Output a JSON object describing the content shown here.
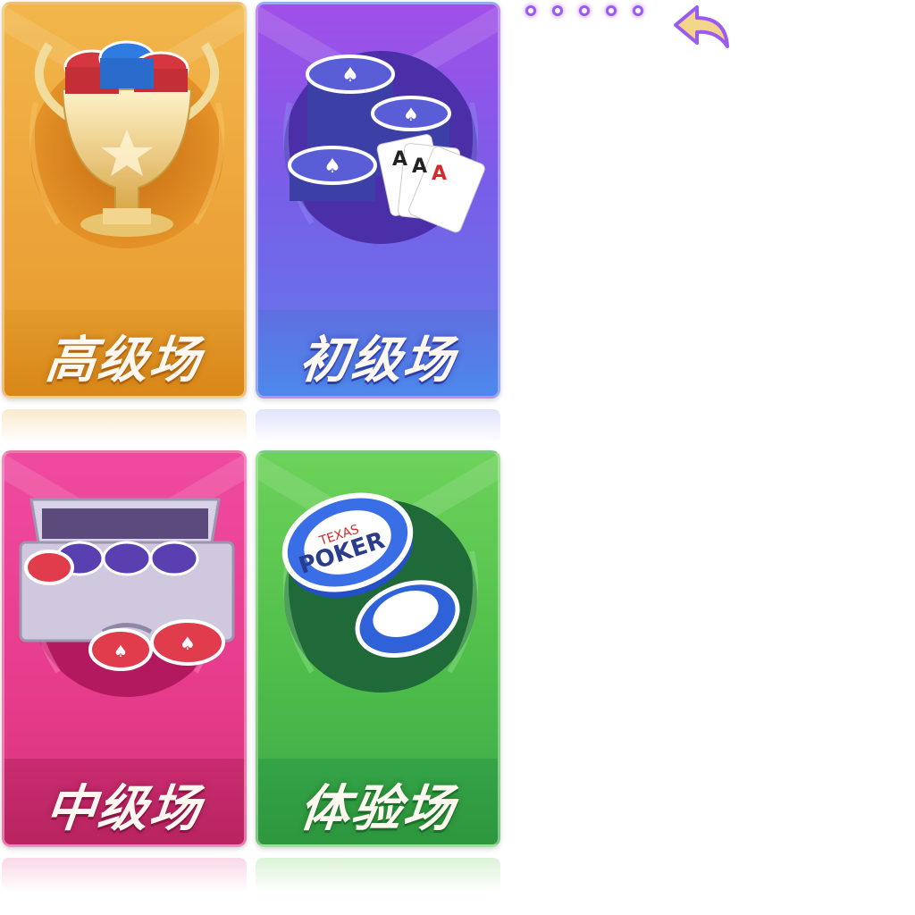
{
  "rooms": [
    {
      "id": "gold",
      "label": "高级场",
      "theme": "#eca43a"
    },
    {
      "id": "purple",
      "label": "初级场",
      "theme": "#7a5de8"
    },
    {
      "id": "pink",
      "label": "中级场",
      "theme": "#e83d8e"
    },
    {
      "id": "green",
      "label": "体验场",
      "theme": "#4fbd4a"
    }
  ],
  "chip_text": {
    "line1": "TEXAS",
    "line2": "POKER"
  },
  "cards_text": {
    "rank": "A"
  },
  "page_indicator": {
    "count": 5,
    "color": "#9b5bf0"
  },
  "back": {
    "icon": "back-arrow-icon",
    "color": "#f3d58a"
  }
}
